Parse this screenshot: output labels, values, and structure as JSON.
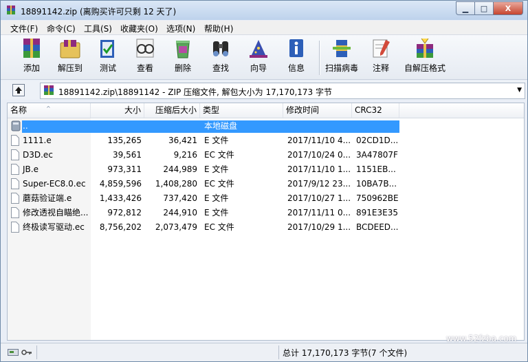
{
  "window": {
    "title": "18891142.zip (离购买许可只剩 12 天了)",
    "controls": {
      "minimize": "▁",
      "maximize": "□",
      "close": "X"
    }
  },
  "menu": [
    "文件(F)",
    "命令(C)",
    "工具(S)",
    "收藏夹(O)",
    "选项(N)",
    "帮助(H)"
  ],
  "toolbar": [
    "添加",
    "解压到",
    "测试",
    "查看",
    "删除",
    "查找",
    "向导",
    "信息",
    "扫描病毒",
    "注释",
    "自解压格式"
  ],
  "address": {
    "path": "18891142.zip\\18891142 - ZIP 压缩文件, 解包大小为 17,170,173 字节",
    "dropdown": "▼"
  },
  "columns": {
    "name": "名称",
    "size": "大小",
    "packed": "压缩后大小",
    "type": "类型",
    "modified": "修改时间",
    "crc": "CRC32"
  },
  "sort_indicator": "^",
  "parent_row": {
    "name": "..",
    "type": "本地磁盘"
  },
  "files": [
    {
      "name": "1111.e",
      "size": "135,265",
      "packed": "36,421",
      "type": "E 文件",
      "modified": "2017/11/10 4...",
      "crc": "02CD1D..."
    },
    {
      "name": "D3D.ec",
      "size": "39,561",
      "packed": "9,216",
      "type": "EC 文件",
      "modified": "2017/10/24 0...",
      "crc": "3A47807F"
    },
    {
      "name": "JB.e",
      "size": "973,311",
      "packed": "244,989",
      "type": "E 文件",
      "modified": "2017/11/10 1...",
      "crc": "1151EB..."
    },
    {
      "name": "Super-EC8.0.ec",
      "size": "4,859,596",
      "packed": "1,408,280",
      "type": "EC 文件",
      "modified": "2017/9/12 23...",
      "crc": "10BA7B..."
    },
    {
      "name": "蘑菇验证端.e",
      "size": "1,433,426",
      "packed": "737,420",
      "type": "E 文件",
      "modified": "2017/10/27 1...",
      "crc": "750962BE"
    },
    {
      "name": "修改透视自瞄绝...",
      "size": "972,812",
      "packed": "244,910",
      "type": "E 文件",
      "modified": "2017/11/11 0...",
      "crc": "891E3E35"
    },
    {
      "name": "终极读写驱动.ec",
      "size": "8,756,202",
      "packed": "2,073,479",
      "type": "EC 文件",
      "modified": "2017/10/29 1...",
      "crc": "BCDEED..."
    }
  ],
  "status": {
    "total": "总计 17,170,173 字节(7 个文件)"
  },
  "watermark": "www.52fzba.com",
  "colors": {
    "selection": "#3399ff",
    "close_button": "#c6452f"
  }
}
